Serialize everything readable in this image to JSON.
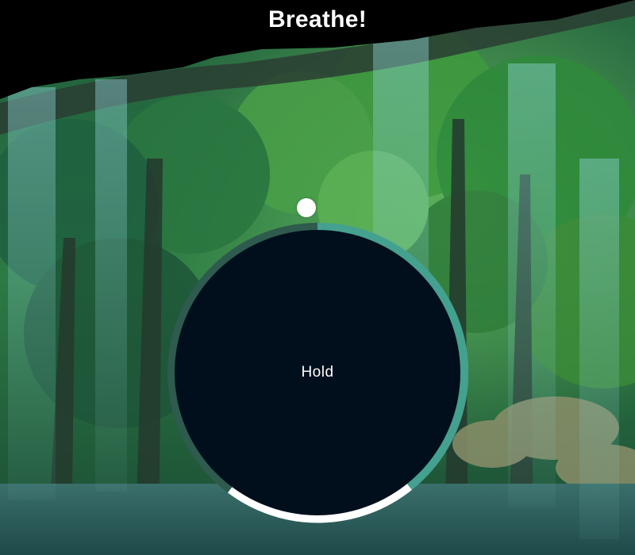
{
  "app": {
    "title": "Breathe!"
  },
  "breathing": {
    "phase_text": "Hold",
    "pointer_icon": "dot-icon",
    "ring_colors": {
      "breathe_in": "#44a08f",
      "hold": "#ffffff",
      "breathe_out": "#2f5a4e"
    },
    "background": {
      "scene": "forest-stream",
      "accent": "#3d8a6a"
    }
  }
}
